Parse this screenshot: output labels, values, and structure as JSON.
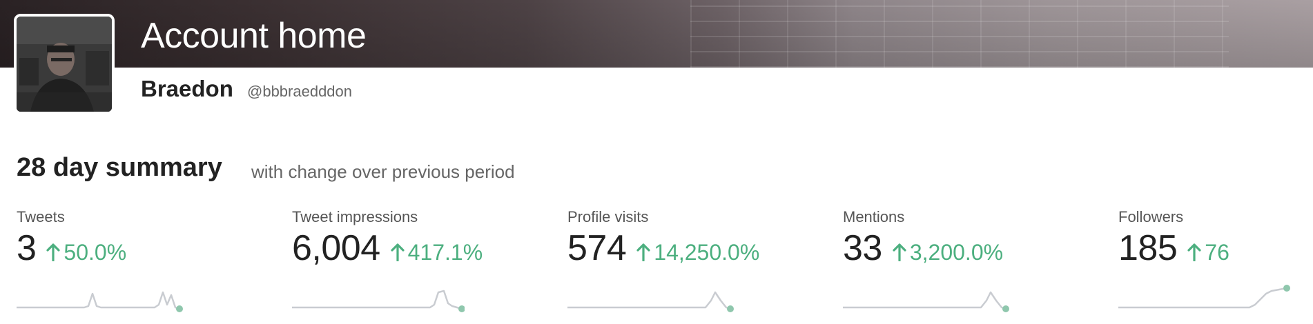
{
  "header": {
    "title": "Account home"
  },
  "profile": {
    "name": "Braedon",
    "handle": "@bbbraedddon"
  },
  "summary": {
    "title": "28 day summary",
    "subtitle": "with change over previous period"
  },
  "colors": {
    "positive": "#4caf7f",
    "sparkline": "#c9ccd1",
    "sparkline_dot": "#8fc7ad"
  },
  "stats": [
    {
      "label": "Tweets",
      "value": "3",
      "change": "50.0%",
      "trend_icon": "arrow-up-icon"
    },
    {
      "label": "Tweet impressions",
      "value": "6,004",
      "change": "417.1%",
      "trend_icon": "arrow-up-icon"
    },
    {
      "label": "Profile visits",
      "value": "574",
      "change": "14,250.0%",
      "trend_icon": "arrow-up-icon"
    },
    {
      "label": "Mentions",
      "value": "33",
      "change": "3,200.0%",
      "trend_icon": "arrow-up-icon"
    },
    {
      "label": "Followers",
      "value": "185",
      "change": "76",
      "trend_icon": "arrow-up-icon"
    }
  ]
}
